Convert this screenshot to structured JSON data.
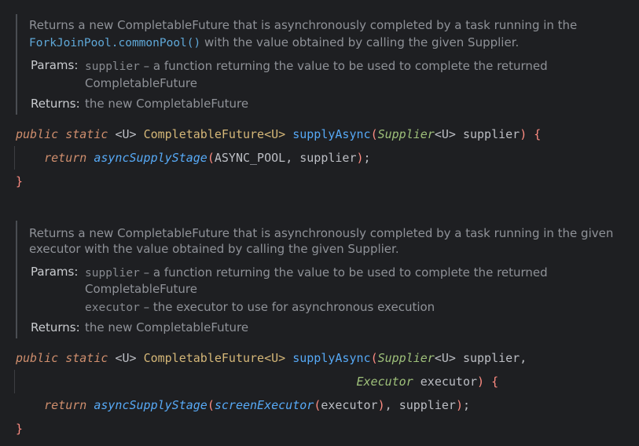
{
  "doc1": {
    "desc_line1": "Returns a new CompletableFuture that is asynchronously completed by a task running in the",
    "desc_line2_link": "ForkJoinPool.commonPool()",
    "desc_line2_rest": " with the value obtained by calling the given Supplier.",
    "params_label": "Params:",
    "param1_name": "supplier",
    "param1_text": " – a function returning the value to be used to complete the returned",
    "param1_cont": "CompletableFuture",
    "returns_label": "Returns:",
    "returns_text": "the new CompletableFuture"
  },
  "code1": {
    "kw_public": "public",
    "kw_static": "static",
    "type_param": "<U>",
    "ret_type": "CompletableFuture<U>",
    "method_name": "supplyAsync",
    "param_type": "Supplier",
    "param_generic": "<U>",
    "param_name": "supplier",
    "kw_return": "return",
    "call_name": "asyncSupplyStage",
    "arg1": "ASYNC_POOL",
    "arg2": "supplier"
  },
  "doc2": {
    "desc_line1": "Returns a new CompletableFuture that is asynchronously completed by a task running in the given",
    "desc_line2": "executor with the value obtained by calling the given Supplier.",
    "params_label": "Params:",
    "param1_name": "supplier",
    "param1_text": " – a function returning the value to be used to complete the returned",
    "param1_cont": "CompletableFuture",
    "param2_name": "executor",
    "param2_text": " – the executor to use for asynchronous execution",
    "returns_label": "Returns:",
    "returns_text": "the new CompletableFuture"
  },
  "code2": {
    "kw_public": "public",
    "kw_static": "static",
    "type_param": "<U>",
    "ret_type": "CompletableFuture<U>",
    "method_name": "supplyAsync",
    "param_type": "Supplier",
    "param_generic": "<U>",
    "param_name": "supplier,",
    "param2_type": "Executor",
    "param2_name": "executor",
    "kw_return": "return",
    "call_name": "asyncSupplyStage",
    "inner_call": "screenExecutor",
    "inner_arg": "executor",
    "arg2": "supplier"
  },
  "colors": {
    "background": "#1e1f22",
    "keyword": "#cf8e6d",
    "method": "#56a8f5",
    "type": "#d5b778",
    "italic_type": "#9ec07a",
    "brace": "#ff8c82",
    "doc_text": "#8f9298"
  }
}
